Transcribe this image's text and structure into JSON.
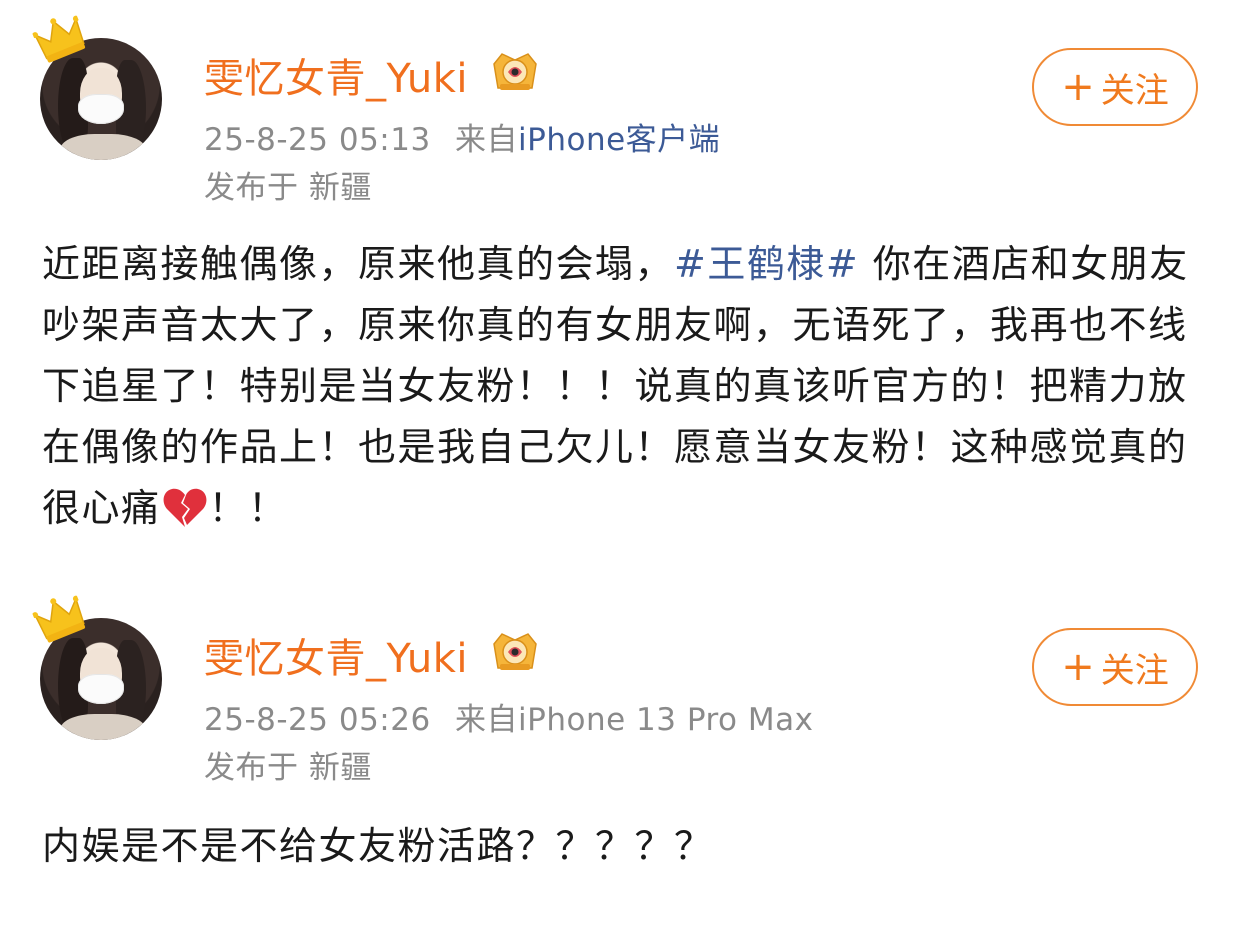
{
  "posts": [
    {
      "author": {
        "name": "雯忆女青_Yuki",
        "avatar_icon": "avatar-masked-girl",
        "crown_icon": "gold-crown-icon",
        "badge_icon": "vip-badge-icon"
      },
      "time": "25-8-25 05:13",
      "source_prefix": "来自",
      "source": "iPhone客户端",
      "location": "发布于 新疆",
      "follow_label": "关注",
      "follow_prefix": "+",
      "content": {
        "before_hashtag": "近距离接触偶像，原来他真的会塌，",
        "hashtag": "#王鹤棣#",
        "after_hashtag": " 你在酒店和女朋友吵架声音太大了，原来你真的有女朋友啊，无语死了，我再也不线下追星了！特别是当女友粉！！！说真的真该听官方的！把精力放在偶像的作品上！也是我自己欠儿！愿意当女友粉！这种感觉真的很心痛",
        "emoji": "broken-heart",
        "after_emoji": "！！"
      }
    },
    {
      "author": {
        "name": "雯忆女青_Yuki",
        "avatar_icon": "avatar-masked-girl",
        "crown_icon": "gold-crown-icon",
        "badge_icon": "vip-badge-icon"
      },
      "time": "25-8-25 05:26",
      "source_prefix": "来自",
      "source": "iPhone 13 Pro Max",
      "location": "发布于 新疆",
      "follow_label": "关注",
      "follow_prefix": "+",
      "content": {
        "text": "内娱是不是不给女友粉活路？？？？？"
      }
    }
  ],
  "colors": {
    "username": "#f06f1e",
    "link": "#3c5a96",
    "meta": "#8a8a8a",
    "follow_border": "#f08a35",
    "text": "#1a1a1a"
  }
}
